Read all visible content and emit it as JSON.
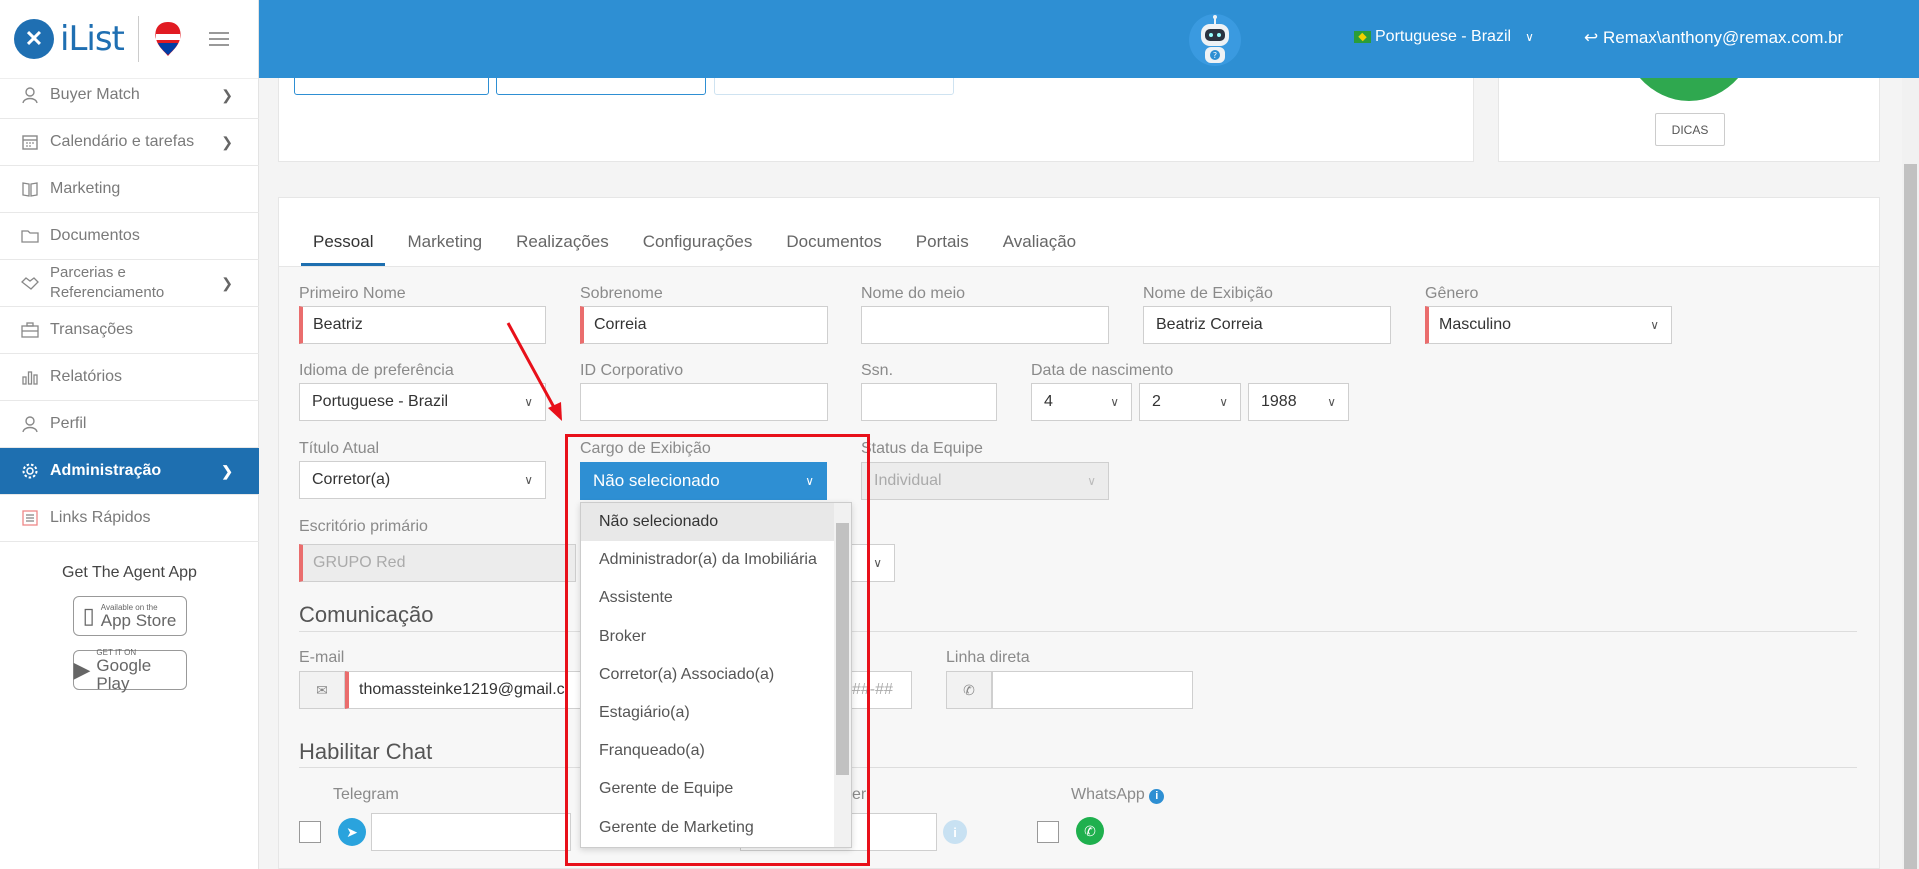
{
  "brand": {
    "name": "iList"
  },
  "sidebar": {
    "items": [
      {
        "label": "Buyer Match",
        "icon": "user-search-icon",
        "has_children": true
      },
      {
        "label": "Calendário e tarefas",
        "icon": "calendar-icon",
        "has_children": true
      },
      {
        "label": "Marketing",
        "icon": "book-icon",
        "has_children": false
      },
      {
        "label": "Documentos",
        "icon": "folder-icon",
        "has_children": false
      },
      {
        "label": "Parcerias e Referenciamento",
        "icon": "handshake-icon",
        "has_children": true
      },
      {
        "label": "Transações",
        "icon": "briefcase-icon",
        "has_children": false
      },
      {
        "label": "Relatórios",
        "icon": "bar-chart-icon",
        "has_children": false
      },
      {
        "label": "Perfil",
        "icon": "user-icon",
        "has_children": false
      },
      {
        "label": "Administração",
        "icon": "gear-icon",
        "has_children": true,
        "active": true
      },
      {
        "label": "Links Rápidos",
        "icon": "link-icon",
        "has_children": false
      }
    ],
    "agent_app_title": "Get The Agent App",
    "appstore_small": "Available on the",
    "appstore_big": "App Store",
    "googleplay_small": "GET IT ON",
    "googleplay_big": "Google Play"
  },
  "header": {
    "language": "Portuguese - Brazil",
    "user": "Remax\\anthony@remax.com.br"
  },
  "top_card": {
    "dicas": "DICAS"
  },
  "tabs": [
    "Pessoal",
    "Marketing",
    "Realizações",
    "Configurações",
    "Documentos",
    "Portais",
    "Avaliação"
  ],
  "form": {
    "primeiro_nome": {
      "label": "Primeiro Nome",
      "value": "Beatriz"
    },
    "sobrenome": {
      "label": "Sobrenome",
      "value": "Correia"
    },
    "nome_meio": {
      "label": "Nome do meio",
      "value": ""
    },
    "nome_exibicao": {
      "label": "Nome de Exibição",
      "value": "Beatriz Correia"
    },
    "genero": {
      "label": "Gênero",
      "value": "Masculino"
    },
    "idioma": {
      "label": "Idioma de preferência",
      "value": "Portuguese - Brazil"
    },
    "id_corporativo": {
      "label": "ID Corporativo",
      "value": ""
    },
    "ssn": {
      "label": "Ssn.",
      "value": ""
    },
    "data_nascimento": {
      "label": "Data de nascimento",
      "day": "4",
      "month": "2",
      "year": "1988"
    },
    "titulo_atual": {
      "label": "Título Atual",
      "value": "Corretor(a)"
    },
    "cargo_exibicao": {
      "label": "Cargo de Exibição",
      "value": "Não selecionado"
    },
    "status_equipe": {
      "label": "Status da Equipe",
      "value": "Individual"
    },
    "escritorio": {
      "label": "Escritório primário",
      "value": "GRUPO Red"
    },
    "comunicacao": "Comunicação",
    "email": {
      "label": "E-mail",
      "value": "thomassteinke1219@gmail.c"
    },
    "phone_partial": "##-##",
    "linha_direta": {
      "label": "Linha direta",
      "value": ""
    },
    "habilitar_chat": "Habilitar Chat",
    "telegram": "Telegram",
    "messenger_partial": "er",
    "whatsapp": "WhatsApp"
  },
  "dropdown_options": [
    "Não selecionado",
    "Administrador(a) da Imobiliária",
    "Assistente",
    "Broker",
    "Corretor(a) Associado(a)",
    "Estagiário(a)",
    "Franqueado(a)",
    "Gerente de Equipe",
    "Gerente de Marketing"
  ],
  "colors": {
    "primary": "#2e8fd3",
    "sidebar_active": "#1e6fb0",
    "required": "#ea6d6d",
    "annotation": "#e8101a"
  }
}
